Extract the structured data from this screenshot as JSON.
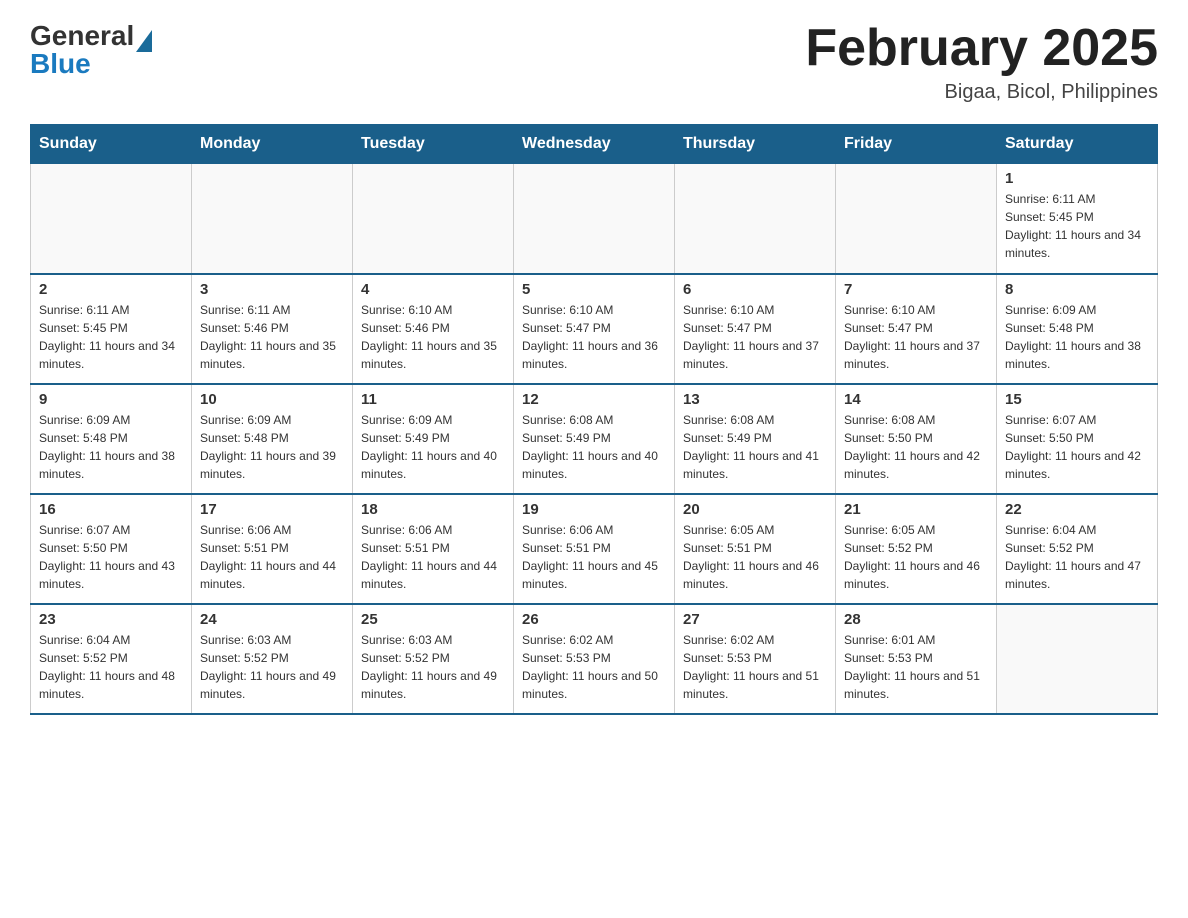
{
  "header": {
    "logo": {
      "general": "General",
      "blue": "Blue"
    },
    "title": "February 2025",
    "subtitle": "Bigaa, Bicol, Philippines"
  },
  "weekdays": [
    "Sunday",
    "Monday",
    "Tuesday",
    "Wednesday",
    "Thursday",
    "Friday",
    "Saturday"
  ],
  "weeks": [
    [
      {
        "day": "",
        "info": ""
      },
      {
        "day": "",
        "info": ""
      },
      {
        "day": "",
        "info": ""
      },
      {
        "day": "",
        "info": ""
      },
      {
        "day": "",
        "info": ""
      },
      {
        "day": "",
        "info": ""
      },
      {
        "day": "1",
        "info": "Sunrise: 6:11 AM\nSunset: 5:45 PM\nDaylight: 11 hours and 34 minutes."
      }
    ],
    [
      {
        "day": "2",
        "info": "Sunrise: 6:11 AM\nSunset: 5:45 PM\nDaylight: 11 hours and 34 minutes."
      },
      {
        "day": "3",
        "info": "Sunrise: 6:11 AM\nSunset: 5:46 PM\nDaylight: 11 hours and 35 minutes."
      },
      {
        "day": "4",
        "info": "Sunrise: 6:10 AM\nSunset: 5:46 PM\nDaylight: 11 hours and 35 minutes."
      },
      {
        "day": "5",
        "info": "Sunrise: 6:10 AM\nSunset: 5:47 PM\nDaylight: 11 hours and 36 minutes."
      },
      {
        "day": "6",
        "info": "Sunrise: 6:10 AM\nSunset: 5:47 PM\nDaylight: 11 hours and 37 minutes."
      },
      {
        "day": "7",
        "info": "Sunrise: 6:10 AM\nSunset: 5:47 PM\nDaylight: 11 hours and 37 minutes."
      },
      {
        "day": "8",
        "info": "Sunrise: 6:09 AM\nSunset: 5:48 PM\nDaylight: 11 hours and 38 minutes."
      }
    ],
    [
      {
        "day": "9",
        "info": "Sunrise: 6:09 AM\nSunset: 5:48 PM\nDaylight: 11 hours and 38 minutes."
      },
      {
        "day": "10",
        "info": "Sunrise: 6:09 AM\nSunset: 5:48 PM\nDaylight: 11 hours and 39 minutes."
      },
      {
        "day": "11",
        "info": "Sunrise: 6:09 AM\nSunset: 5:49 PM\nDaylight: 11 hours and 40 minutes."
      },
      {
        "day": "12",
        "info": "Sunrise: 6:08 AM\nSunset: 5:49 PM\nDaylight: 11 hours and 40 minutes."
      },
      {
        "day": "13",
        "info": "Sunrise: 6:08 AM\nSunset: 5:49 PM\nDaylight: 11 hours and 41 minutes."
      },
      {
        "day": "14",
        "info": "Sunrise: 6:08 AM\nSunset: 5:50 PM\nDaylight: 11 hours and 42 minutes."
      },
      {
        "day": "15",
        "info": "Sunrise: 6:07 AM\nSunset: 5:50 PM\nDaylight: 11 hours and 42 minutes."
      }
    ],
    [
      {
        "day": "16",
        "info": "Sunrise: 6:07 AM\nSunset: 5:50 PM\nDaylight: 11 hours and 43 minutes."
      },
      {
        "day": "17",
        "info": "Sunrise: 6:06 AM\nSunset: 5:51 PM\nDaylight: 11 hours and 44 minutes."
      },
      {
        "day": "18",
        "info": "Sunrise: 6:06 AM\nSunset: 5:51 PM\nDaylight: 11 hours and 44 minutes."
      },
      {
        "day": "19",
        "info": "Sunrise: 6:06 AM\nSunset: 5:51 PM\nDaylight: 11 hours and 45 minutes."
      },
      {
        "day": "20",
        "info": "Sunrise: 6:05 AM\nSunset: 5:51 PM\nDaylight: 11 hours and 46 minutes."
      },
      {
        "day": "21",
        "info": "Sunrise: 6:05 AM\nSunset: 5:52 PM\nDaylight: 11 hours and 46 minutes."
      },
      {
        "day": "22",
        "info": "Sunrise: 6:04 AM\nSunset: 5:52 PM\nDaylight: 11 hours and 47 minutes."
      }
    ],
    [
      {
        "day": "23",
        "info": "Sunrise: 6:04 AM\nSunset: 5:52 PM\nDaylight: 11 hours and 48 minutes."
      },
      {
        "day": "24",
        "info": "Sunrise: 6:03 AM\nSunset: 5:52 PM\nDaylight: 11 hours and 49 minutes."
      },
      {
        "day": "25",
        "info": "Sunrise: 6:03 AM\nSunset: 5:52 PM\nDaylight: 11 hours and 49 minutes."
      },
      {
        "day": "26",
        "info": "Sunrise: 6:02 AM\nSunset: 5:53 PM\nDaylight: 11 hours and 50 minutes."
      },
      {
        "day": "27",
        "info": "Sunrise: 6:02 AM\nSunset: 5:53 PM\nDaylight: 11 hours and 51 minutes."
      },
      {
        "day": "28",
        "info": "Sunrise: 6:01 AM\nSunset: 5:53 PM\nDaylight: 11 hours and 51 minutes."
      },
      {
        "day": "",
        "info": ""
      }
    ]
  ]
}
